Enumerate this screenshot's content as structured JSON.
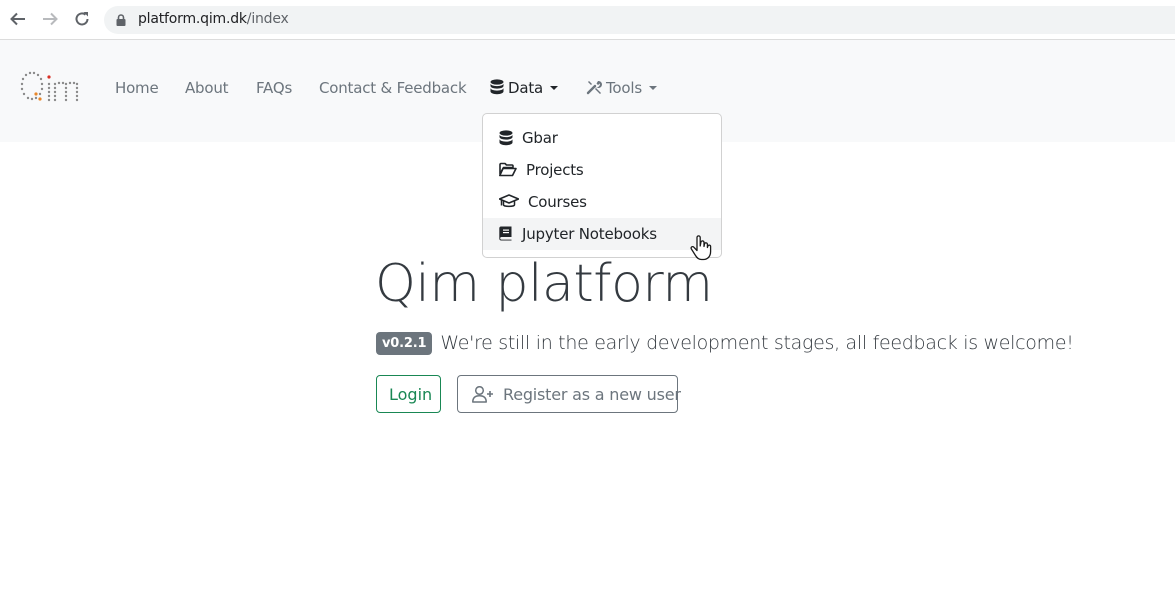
{
  "browser": {
    "url_domain": "platform.qim.dk",
    "url_path": "/index"
  },
  "navbar": {
    "links": [
      {
        "label": "Home"
      },
      {
        "label": "About"
      },
      {
        "label": "FAQs"
      },
      {
        "label": "Contact & Feedback"
      },
      {
        "label": "Data"
      },
      {
        "label": "Tools"
      }
    ]
  },
  "dropdown": {
    "items": [
      {
        "label": "Gbar",
        "icon": "database-icon"
      },
      {
        "label": "Projects",
        "icon": "folder-open-icon"
      },
      {
        "label": "Courses",
        "icon": "graduation-cap-icon"
      },
      {
        "label": "Jupyter Notebooks",
        "icon": "book-icon"
      }
    ]
  },
  "hero": {
    "title": "Qim platform",
    "version_badge": "v0.2.1",
    "lead": "We're still in the early development stages, all feedback is welcome!",
    "login_label": "Login",
    "register_label": "Register as a new user"
  },
  "colors": {
    "navbar_bg": "#f8f9fa",
    "login_green": "#198754",
    "muted_gray": "#6c757d",
    "logo_orange": "#e8872a",
    "logo_red": "#d93025"
  }
}
